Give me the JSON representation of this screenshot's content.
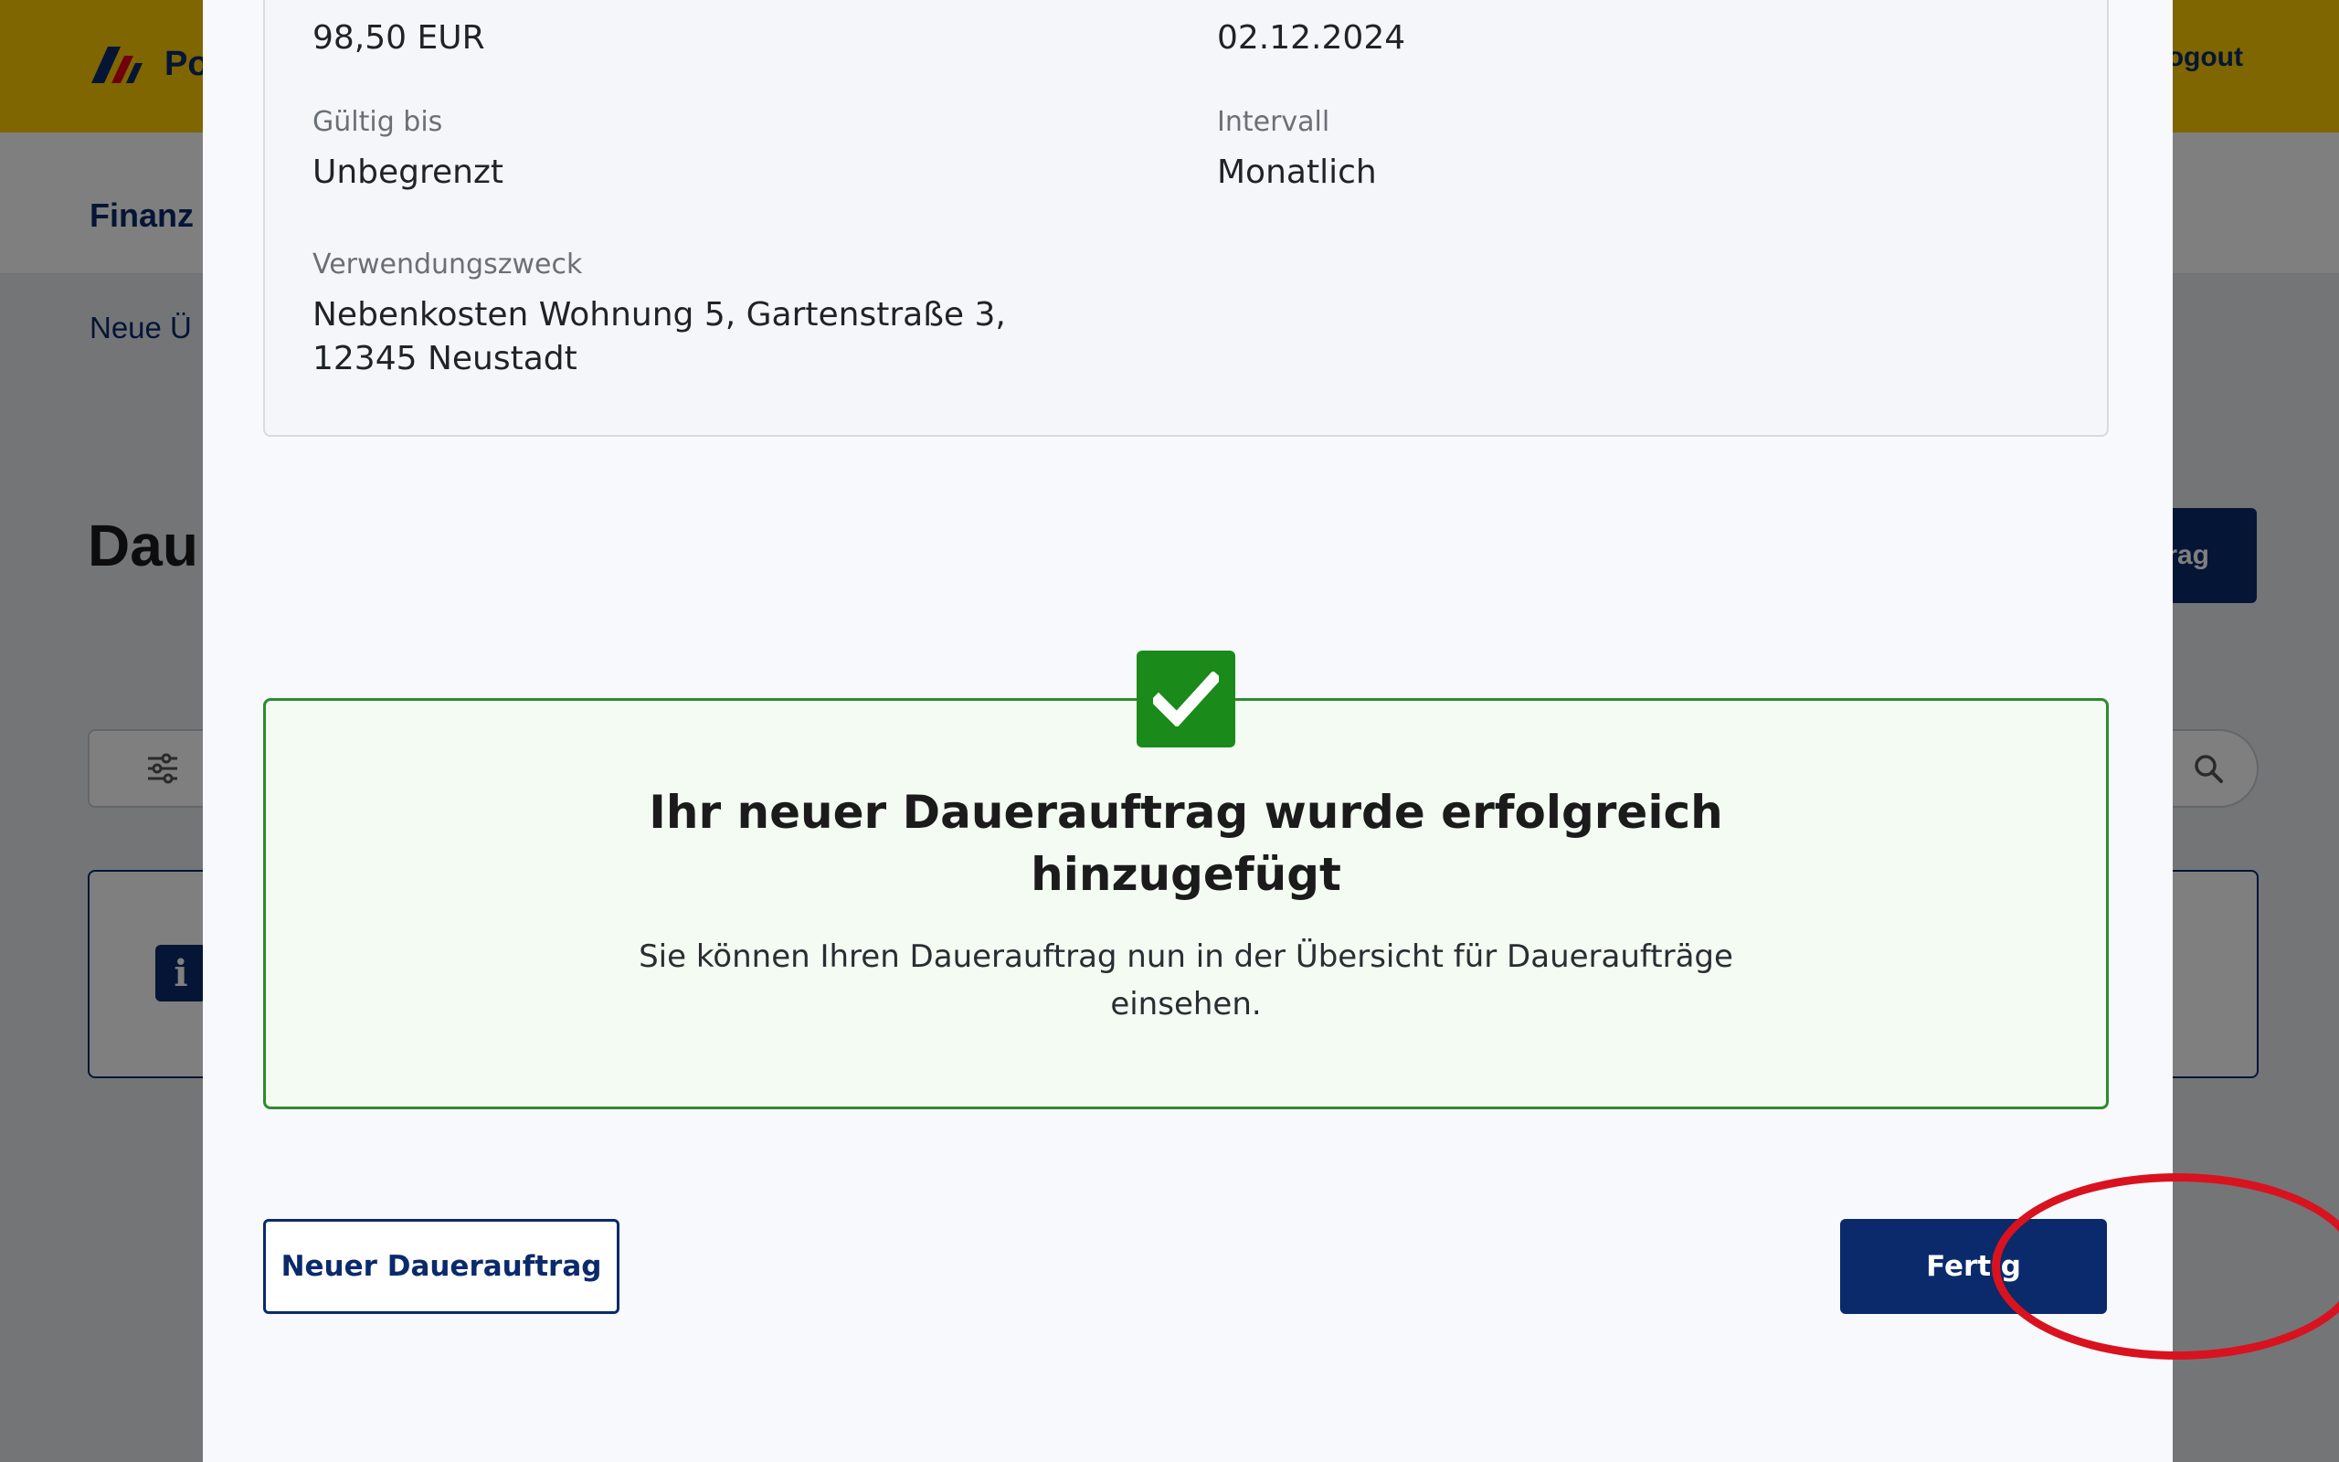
{
  "background": {
    "logo_text": "Po",
    "logout_label": "Logout",
    "nav_label": "Finanz",
    "subnav_label": "Neue Ü",
    "page_title": "Dau",
    "new_button_label": "rag"
  },
  "summary": {
    "amount_value": "98,50 EUR",
    "date_value": "02.12.2024",
    "valid_until_label": "Gültig bis",
    "valid_until_value": "Unbegrenzt",
    "interval_label": "Intervall",
    "interval_value": "Monatlich",
    "purpose_label": "Verwendungszweck",
    "purpose_line1": "Nebenkosten Wohnung 5, Gartenstraße 3,",
    "purpose_line2": "12345 Neustadt"
  },
  "success": {
    "title_line1": "Ihr neuer Dauerauftrag wurde erfolgreich",
    "title_line2": "hinzugefügt",
    "text_line1": "Sie können Ihren Dauerauftrag nun in der Übersicht für Daueraufträge",
    "text_line2": "einsehen."
  },
  "actions": {
    "secondary_label": "Neuer Dauerauftrag",
    "primary_label": "Fertig"
  },
  "colors": {
    "brand_yellow": "#ffcc00",
    "brand_navy": "#0a2a6b",
    "success_green": "#1a8a1a",
    "highlight_red": "#d9121f"
  }
}
